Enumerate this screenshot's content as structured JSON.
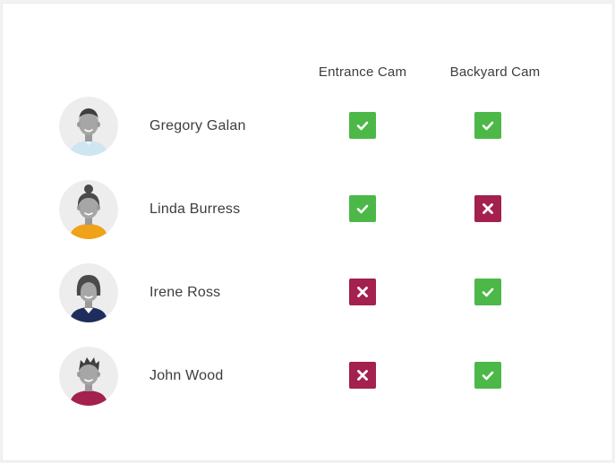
{
  "columns": {
    "entrance": "Entrance Cam",
    "backyard": "Backyard Cam"
  },
  "icons": {
    "allowed": "checkmark-icon",
    "denied": "x-mark-icon",
    "avatar": "person-avatar-icon"
  },
  "colors": {
    "allowed": "#4cb848",
    "denied": "#a3204f",
    "avatar_bg": "#ededed",
    "text": "#3d3d3d"
  },
  "users": [
    {
      "name": "Gregory Galan",
      "entrance": "allowed",
      "backyard": "allowed",
      "shirt_color": "#cfe6f2",
      "hair_color": "#3f3f3f"
    },
    {
      "name": "Linda Burress",
      "entrance": "allowed",
      "backyard": "denied",
      "shirt_color": "#f0a21a",
      "hair_color": "#4a4a4a"
    },
    {
      "name": "Irene Ross",
      "entrance": "denied",
      "backyard": "allowed",
      "shirt_color": "#1f2d5c",
      "hair_color": "#4a4a4a"
    },
    {
      "name": "John Wood",
      "entrance": "denied",
      "backyard": "allowed",
      "shirt_color": "#a3204f",
      "hair_color": "#3f3f3f"
    }
  ]
}
